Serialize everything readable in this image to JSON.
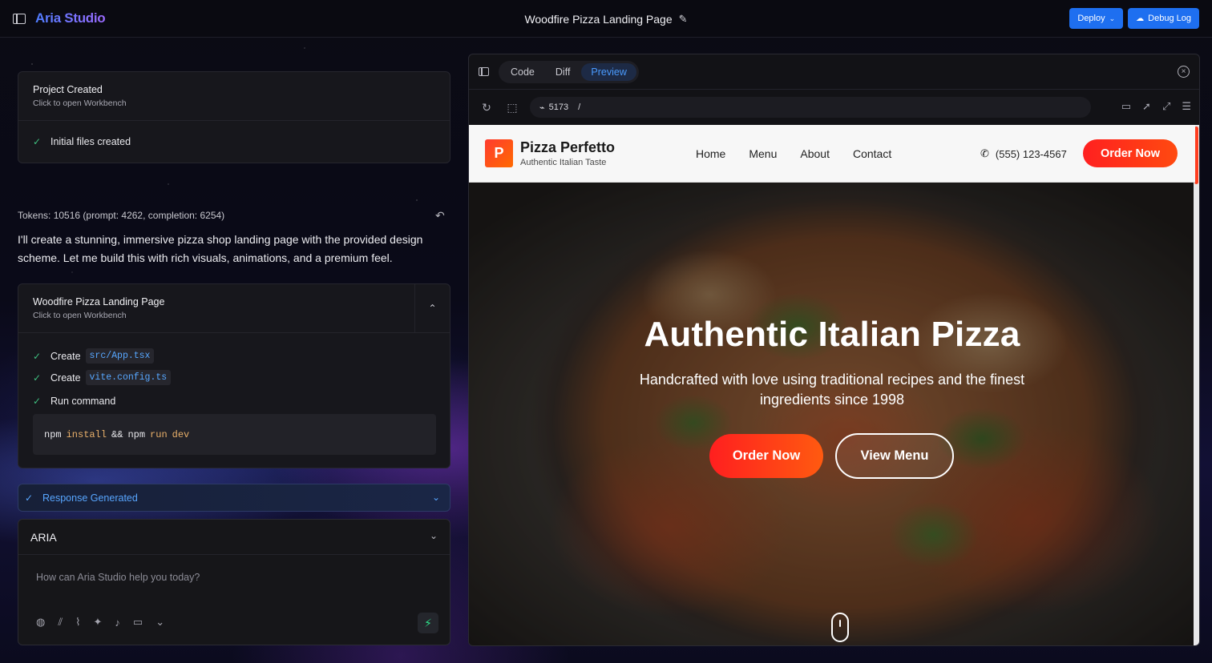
{
  "app": {
    "brand": "Aria Studio",
    "page_title": "Woodfire Pizza Landing Page",
    "deploy_label": "Deploy",
    "debug_label": "Debug Log"
  },
  "chat": {
    "project_card": {
      "title": "Project Created",
      "subtitle": "Click to open Workbench",
      "step": "Initial files created"
    },
    "tokens": "Tokens: 10516 (prompt: 4262, completion: 6254)",
    "message": "I'll create a stunning, immersive pizza shop landing page with the provided design scheme. Let me build this with rich visuals, animations, and a premium feel.",
    "artifact": {
      "title": "Woodfire Pizza Landing Page",
      "subtitle": "Click to open Workbench",
      "steps": [
        {
          "action": "Create",
          "file": "src/App.tsx"
        },
        {
          "action": "Create",
          "file": "vite.config.ts"
        },
        {
          "action": "Run command"
        }
      ],
      "command": {
        "t1": "npm",
        "t2": "install",
        "t3": "&&",
        "t4": "npm",
        "t5": "run",
        "t6": "dev"
      }
    },
    "response_label": "Response Generated",
    "model": "ARIA",
    "input_placeholder": "How can Aria Studio help you today?"
  },
  "preview": {
    "tabs": [
      "Code",
      "Diff",
      "Preview"
    ],
    "active_tab": "Preview",
    "port": "5173",
    "path": "/",
    "site": {
      "logo_letter": "P",
      "name": "Pizza Perfetto",
      "tagline": "Authentic Italian Taste",
      "nav": [
        "Home",
        "Menu",
        "About",
        "Contact"
      ],
      "phone": "(555) 123-4567",
      "order_label": "Order Now",
      "hero_title": "Authentic Italian Pizza",
      "hero_sub": "Handcrafted with love using traditional recipes and the finest ingredients since 1998",
      "hero_order": "Order Now",
      "hero_menu": "View Menu"
    }
  },
  "colors": {
    "accent_blue": "#1e6ff0",
    "brand_red": "#ff2a1a",
    "success_green": "#3fbf7f",
    "link_blue": "#58a6ff"
  },
  "icons": {
    "sidebar": "sidebar-toggle-icon",
    "edit": "pencil-icon",
    "deploy_caret": "chevron-down-icon",
    "debug": "cloud-upload-icon",
    "reload": "reload-icon",
    "select": "select-region-icon",
    "send": "lightning-icon"
  }
}
